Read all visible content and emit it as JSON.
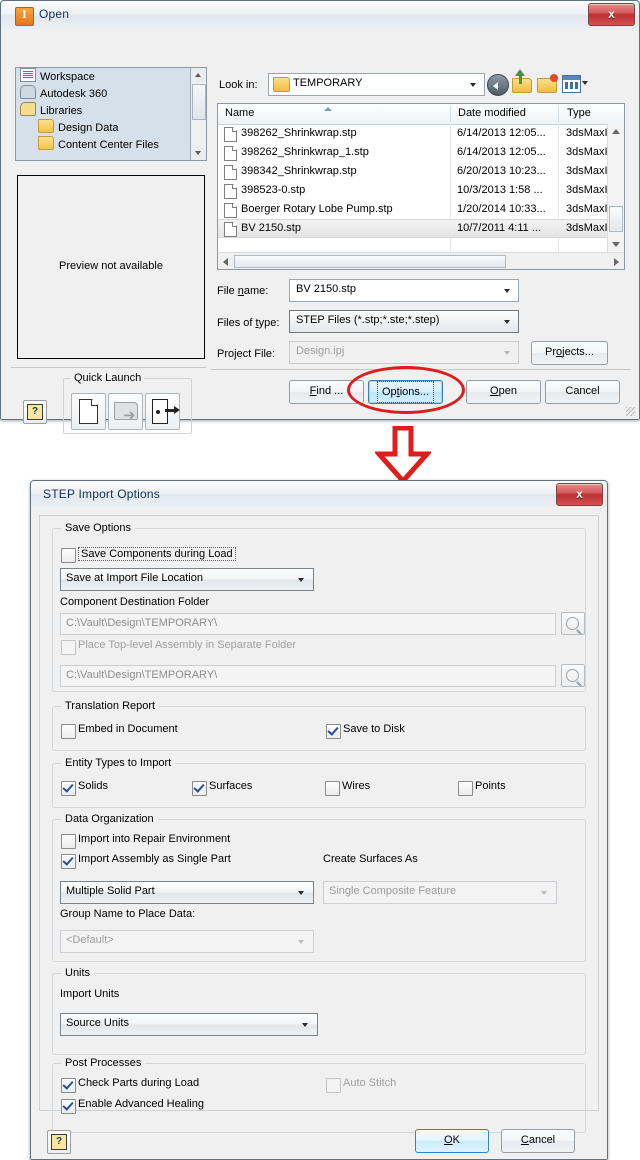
{
  "open_dialog": {
    "title": "Open",
    "app_icon": "inventor-icon",
    "close_label": "x",
    "places": [
      {
        "label": "Workspace",
        "icon": "document-icon",
        "indent": false
      },
      {
        "label": "Autodesk 360",
        "icon": "cloud-icon",
        "indent": false
      },
      {
        "label": "Libraries",
        "icon": "library-icon",
        "indent": false
      },
      {
        "label": "Design Data",
        "icon": "folder-icon",
        "indent": true
      },
      {
        "label": "Content Center Files",
        "icon": "folder-icon",
        "indent": true
      }
    ],
    "preview_text": "Preview not available",
    "quick_launch": {
      "group_label": "Quick Launch",
      "buttons": [
        "new-file-icon",
        "open-folder-icon",
        "exit-door-icon"
      ]
    },
    "help_label": "?",
    "look_in": {
      "label": "Look in:",
      "value": "TEMPORARY"
    },
    "toolbar": [
      "back-icon",
      "up-folder-icon",
      "new-folder-icon",
      "views-icon"
    ],
    "file_list": {
      "columns": [
        "Name",
        "Date modified",
        "Type"
      ],
      "rows": [
        {
          "name": "398262_Shrinkwrap.stp",
          "date": "6/14/2013 12:05...",
          "type": "3dsMaxI",
          "selected": false
        },
        {
          "name": "398262_Shrinkwrap_1.stp",
          "date": "6/14/2013 12:05...",
          "type": "3dsMaxI",
          "selected": false
        },
        {
          "name": "398342_Shrinkwrap.stp",
          "date": "6/20/2013 10:23...",
          "type": "3dsMaxI",
          "selected": false
        },
        {
          "name": "398523-0.stp",
          "date": "10/3/2013 1:58 ...",
          "type": "3dsMaxI",
          "selected": false
        },
        {
          "name": "Boerger Rotary Lobe Pump.stp",
          "date": "1/20/2014 10:33...",
          "type": "3dsMaxI",
          "selected": false
        },
        {
          "name": "BV 2150.stp",
          "date": "10/7/2011 4:11 ...",
          "type": "3dsMaxI",
          "selected": true
        }
      ]
    },
    "fields": {
      "file_name_label": "File name:",
      "file_name_value": "BV 2150.stp",
      "files_of_type_label": "Files of type:",
      "files_of_type_value": "STEP Files (*.stp;*.ste;*.step)",
      "project_file_label": "Project File:",
      "project_file_value": "Design.ipj",
      "projects_button": "Projects..."
    },
    "buttons": {
      "find": "Find ...",
      "options": "Options...",
      "open": "Open",
      "cancel": "Cancel"
    }
  },
  "annotation": {
    "ellipse_target": "options-button",
    "arrow_color": "#e01b1b",
    "ellipse_color": "#e01b1b"
  },
  "step_dialog": {
    "title": "STEP Import Options",
    "close_label": "x",
    "save_options": {
      "group_label": "Save Options",
      "save_components_label": "Save Components during Load",
      "save_components_checked": false,
      "location_combo_value": "Save at Import File Location",
      "component_dest_label": "Component Destination Folder",
      "component_dest_value": "C:\\Vault\\Design\\TEMPORARY\\",
      "place_top_level_label": "Place Top-level Assembly in Separate Folder",
      "place_top_level_checked": false,
      "top_level_path_value": "C:\\Vault\\Design\\TEMPORARY\\",
      "browse_icon": "browse-icon"
    },
    "translation_report": {
      "group_label": "Translation Report",
      "embed_label": "Embed in Document",
      "embed_checked": false,
      "save_to_disk_label": "Save to Disk",
      "save_to_disk_checked": true
    },
    "entity_types": {
      "group_label": "Entity Types to Import",
      "items": [
        {
          "label": "Solids",
          "checked": true
        },
        {
          "label": "Surfaces",
          "checked": true
        },
        {
          "label": "Wires",
          "checked": false
        },
        {
          "label": "Points",
          "checked": false
        }
      ]
    },
    "data_organization": {
      "group_label": "Data Organization",
      "repair_env_label": "Import into Repair Environment",
      "repair_env_checked": false,
      "single_part_label": "Import Assembly as Single Part",
      "single_part_checked": true,
      "part_combo_value": "Multiple Solid Part",
      "create_surfaces_label": "Create Surfaces As",
      "create_surfaces_value": "Single Composite Feature",
      "group_name_label": "Group Name to Place Data:",
      "group_name_value": "<Default>"
    },
    "units": {
      "group_label": "Units",
      "import_units_label": "Import Units",
      "import_units_value": "Source Units"
    },
    "post_processes": {
      "group_label": "Post Processes",
      "check_parts_label": "Check Parts during Load",
      "check_parts_checked": true,
      "advanced_healing_label": "Enable Advanced Healing",
      "advanced_healing_checked": true,
      "auto_stitch_label": "Auto Stitch",
      "auto_stitch_checked": false
    },
    "help_label": "?",
    "ok_label": "OK",
    "cancel_label": "Cancel"
  }
}
